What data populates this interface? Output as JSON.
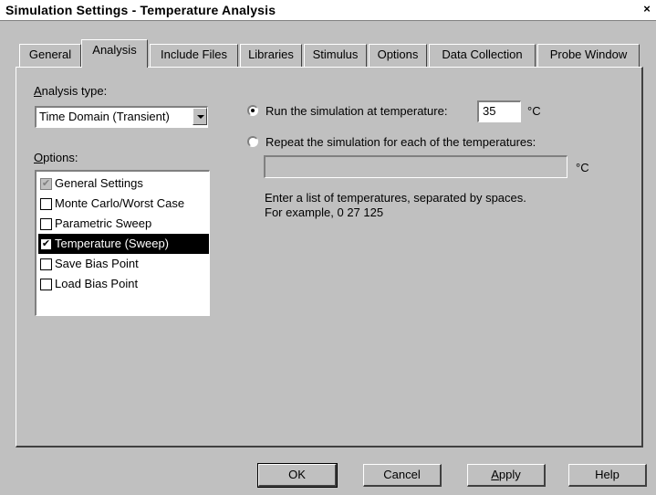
{
  "window": {
    "title": "Simulation Settings - Temperature Analysis",
    "close_label": "×"
  },
  "tabs": [
    {
      "label": "General"
    },
    {
      "label": "Analysis"
    },
    {
      "label": "Include Files"
    },
    {
      "label": "Libraries"
    },
    {
      "label": "Stimulus"
    },
    {
      "label": "Options"
    },
    {
      "label": "Data Collection"
    },
    {
      "label": "Probe Window"
    }
  ],
  "active_tab": "Analysis",
  "analysis_type": {
    "label_hotkey": "A",
    "label_rest": "nalysis type:",
    "selected": "Time Domain (Transient)"
  },
  "options": {
    "label_hotkey": "O",
    "label_rest": "ptions:",
    "items": [
      {
        "label": "General Settings",
        "checked": true,
        "disabled": true,
        "selected": false
      },
      {
        "label": "Monte Carlo/Worst Case",
        "checked": false,
        "disabled": false,
        "selected": false
      },
      {
        "label": "Parametric Sweep",
        "checked": false,
        "disabled": false,
        "selected": false
      },
      {
        "label": "Temperature (Sweep)",
        "checked": true,
        "disabled": false,
        "selected": true
      },
      {
        "label": "Save Bias Point",
        "checked": false,
        "disabled": false,
        "selected": false
      },
      {
        "label": "Load Bias Point",
        "checked": false,
        "disabled": false,
        "selected": false
      }
    ]
  },
  "temperature": {
    "run_label": "Run the simulation at temperature:",
    "run_checked": true,
    "run_value": "35",
    "unit": "°C",
    "repeat_label": "Repeat the simulation for each of the temperatures:",
    "repeat_checked": false,
    "repeat_value": "",
    "help_line1": "Enter a list of temperatures, separated by spaces.",
    "help_line2": "For example, 0  27  125"
  },
  "buttons": {
    "ok": "OK",
    "cancel": "Cancel",
    "apply_hotkey": "A",
    "apply_rest": "pply",
    "help": "Help"
  }
}
